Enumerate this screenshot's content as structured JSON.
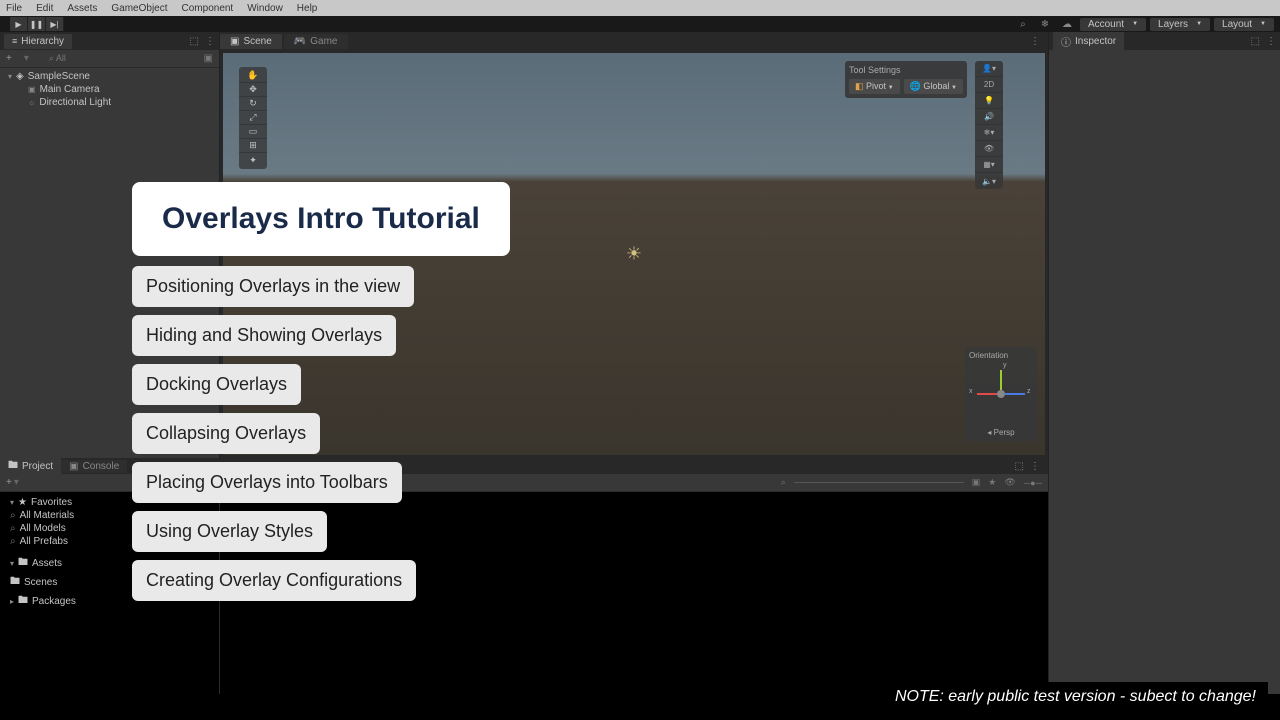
{
  "menu": {
    "items": [
      "File",
      "Edit",
      "Assets",
      "GameObject",
      "Component",
      "Window",
      "Help"
    ]
  },
  "toolbar": {
    "right_dropdowns": [
      "Account",
      "Layers",
      "Layout"
    ]
  },
  "hierarchy": {
    "tab": "Hierarchy",
    "add": "+",
    "search": "All",
    "scene": "SampleScene",
    "items": [
      "Main Camera",
      "Directional Light"
    ]
  },
  "scene": {
    "tab": "Scene",
    "game_tab": "Game",
    "tool_settings_label": "Tool Settings",
    "pivot": "Pivot",
    "global": "Global",
    "orientation": "Orientation",
    "persp": "Persp",
    "axis_x": "x",
    "axis_y": "y",
    "axis_z": "z",
    "right_strip_2d": "2D"
  },
  "project": {
    "tab": "Project",
    "console_tab": "Console",
    "add": "+",
    "favorites": "Favorites",
    "fav_items": [
      "All Materials",
      "All Models",
      "All Prefabs"
    ],
    "assets": "Assets",
    "assets_items": [
      "Scenes"
    ],
    "packages": "Packages"
  },
  "inspector": {
    "tab": "Inspector"
  },
  "tutorial": {
    "title": "Overlays Intro Tutorial",
    "items": [
      "Positioning Overlays in the view",
      "Hiding and Showing Overlays",
      "Docking Overlays",
      "Collapsing Overlays",
      "Placing Overlays into Toolbars",
      "Using Overlay Styles",
      "Creating Overlay Configurations"
    ]
  },
  "footer": {
    "note": "NOTE: early public test version - subect to change!"
  }
}
